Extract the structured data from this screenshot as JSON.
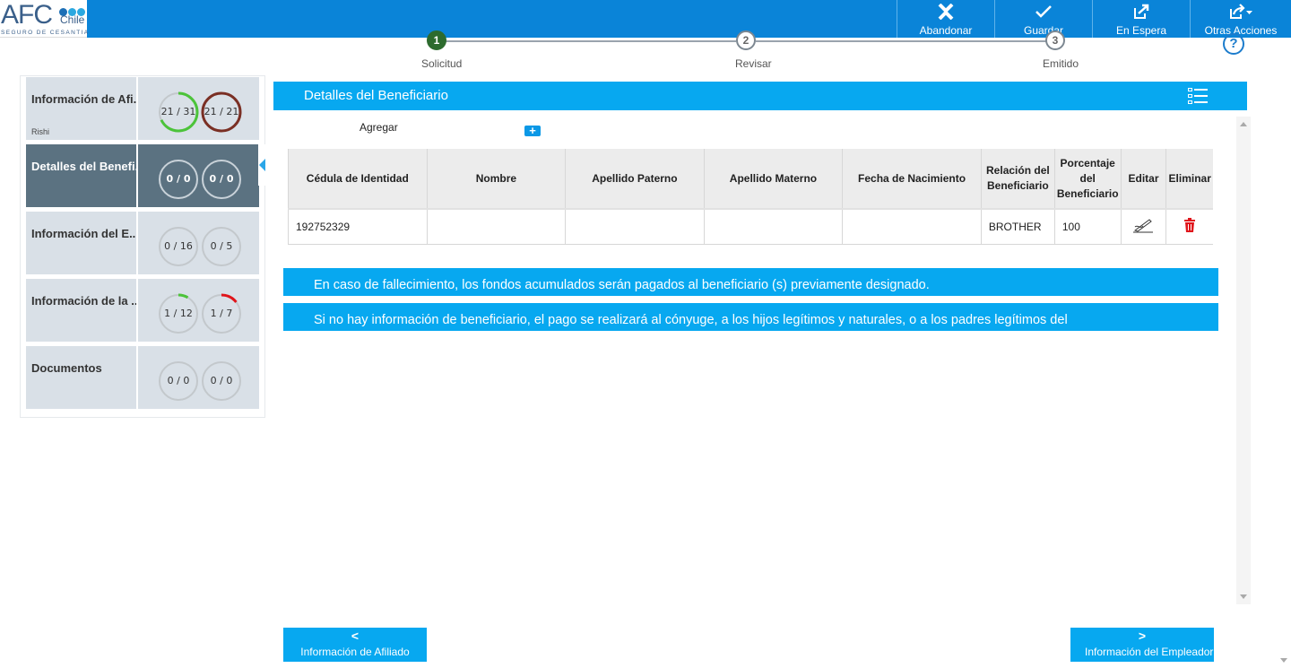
{
  "brand": {
    "name": "AFC",
    "sub": "Chile",
    "tagline": "SEGURO DE CESANTIA"
  },
  "toolbar": [
    {
      "label": "Abandonar",
      "icon": "close-x-icon"
    },
    {
      "label": "Guardar",
      "icon": "checkmark-icon"
    },
    {
      "label": "En Espera",
      "icon": "pending-export-icon"
    },
    {
      "label": "Otras Acciones",
      "icon": "share-dropdown-icon"
    }
  ],
  "stepper": [
    {
      "num": "1",
      "label": "Solicitud",
      "state": "active"
    },
    {
      "num": "2",
      "label": "Revisar",
      "state": "pending"
    },
    {
      "num": "3",
      "label": "Emitido",
      "state": "pending"
    }
  ],
  "help": "?",
  "sidebar": [
    {
      "title": "Información de Afi...",
      "sub": "Rishi",
      "left": "21 / 31",
      "right": "21 / 21",
      "left_progress": 0.68,
      "right_progress": 1.0,
      "left_color": "#4cc33a",
      "right_color": "#7a2f24",
      "active": false
    },
    {
      "title": "Detalles del Benefi...",
      "sub": "",
      "left": "0 / 0",
      "right": "0 / 0",
      "left_progress": 0,
      "right_progress": 0,
      "left_color": "#4cc33a",
      "right_color": "#e0151b",
      "active": true
    },
    {
      "title": "Información del E...",
      "sub": "",
      "left": "0 / 16",
      "right": "0 / 5",
      "left_progress": 0,
      "right_progress": 0,
      "left_color": "#4cc33a",
      "right_color": "#e0151b",
      "active": false
    },
    {
      "title": "Información de la ...",
      "sub": "",
      "left": "1 / 12",
      "right": "1 / 7",
      "left_progress": 0.083,
      "right_progress": 0.143,
      "left_color": "#4cc33a",
      "right_color": "#e0151b",
      "active": false
    },
    {
      "title": "Documentos",
      "sub": "",
      "left": "0 / 0",
      "right": "0 / 0",
      "left_progress": 0,
      "right_progress": 0,
      "left_color": "#4cc33a",
      "right_color": "#e0151b",
      "active": false
    }
  ],
  "section": {
    "title": "Detalles del Beneficiario",
    "icon": "list-view-icon"
  },
  "add": {
    "label": "Agregar",
    "button": "+"
  },
  "table": {
    "headers": [
      "Cédula de Identidad",
      "Nombre",
      "Apellido Paterno",
      "Apellido Materno",
      "Fecha de Nacimiento",
      "Relación del Beneficiario",
      "Porcentaje del Beneficiario",
      "Editar",
      "Eliminar"
    ],
    "rows": [
      {
        "cedula": "192752329",
        "nombre": "",
        "paterno": "",
        "materno": "",
        "nacimiento": "",
        "relacion": "BROTHER",
        "porcentaje": "100"
      }
    ]
  },
  "notices": [
    "En caso de fallecimiento, los fondos acumulados serán pagados al beneficiario (s) previamente designado.",
    "Si no hay información de beneficiario, el pago se realizará al cónyuge, a los hijos legítimos y naturales, o a los padres legítimos del"
  ],
  "nav": {
    "prev": {
      "arrow": "<",
      "label": "Información de Afiliado"
    },
    "next": {
      "arrow": ">",
      "label": "Información del Empleador"
    }
  }
}
